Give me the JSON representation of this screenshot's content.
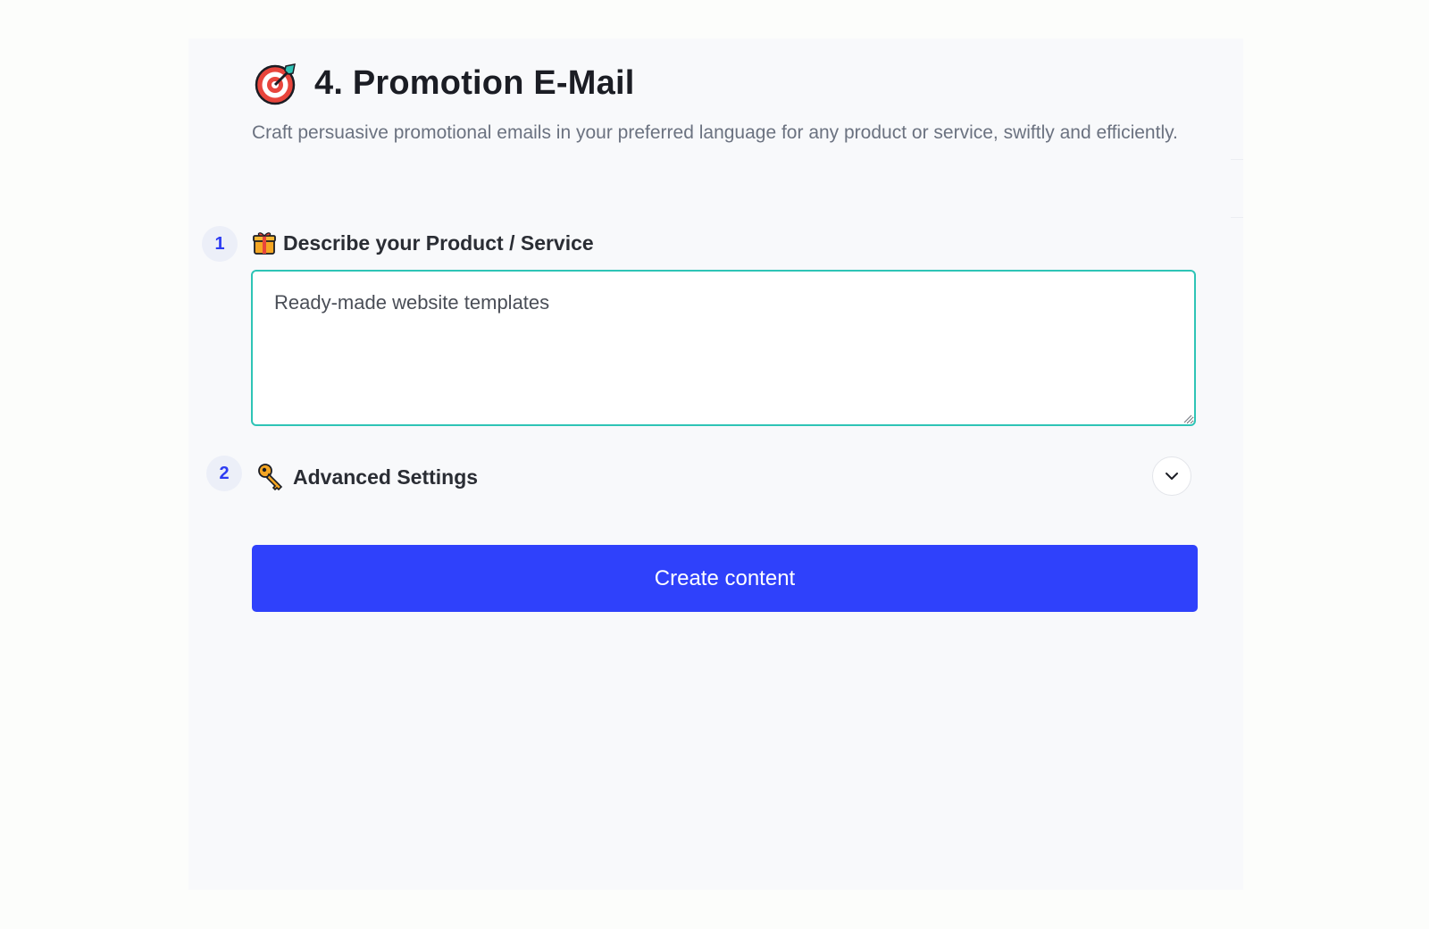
{
  "page": {
    "title": "4. Promotion E-Mail",
    "title_icon": "target-icon",
    "subtitle": "Craft persuasive promotional emails in your preferred language for any product or service, swiftly and efficiently."
  },
  "steps": [
    {
      "number": "1",
      "icon": "gift-icon",
      "label": "Describe your Product / Service",
      "value": "Ready-made website templates"
    },
    {
      "number": "2",
      "icon": "key-icon",
      "label": "Advanced Settings",
      "toggle_icon": "chevron-down-icon"
    }
  ],
  "actions": {
    "create_label": "Create content"
  },
  "colors": {
    "accent": "#2f41fb",
    "input_border": "#2ec4b6",
    "badge_bg": "#eceff8",
    "badge_text": "#2d3cf2"
  }
}
